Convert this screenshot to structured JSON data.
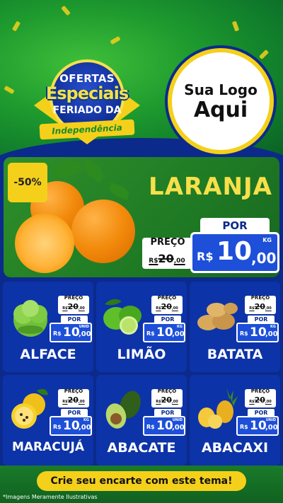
{
  "header": {
    "badge": {
      "line1": "OFERTAS",
      "line2": "Especiais",
      "line3": "FERIADO DA",
      "ribbon": "Independência"
    },
    "logo": {
      "line1": "Sua Logo",
      "line2": "Aqui"
    }
  },
  "hero": {
    "discount": "-50%",
    "name": "LARANJA",
    "preco_label": "PREÇO",
    "old_currency": "R$",
    "old_int": "20",
    "old_dec": ",00",
    "por_label": "POR",
    "currency": "R$",
    "price_int": "10",
    "price_dec": ",00",
    "unit": "KG"
  },
  "products": [
    {
      "name": "ALFACE",
      "preco_label": "PREÇO",
      "old_currency": "R$",
      "old_int": "20",
      "old_dec": ",00",
      "por_label": "POR",
      "currency": "R$",
      "price_int": "10",
      "price_dec": ",00",
      "unit": "UNID"
    },
    {
      "name": "LIMÃO",
      "preco_label": "PREÇO",
      "old_currency": "R$",
      "old_int": "20",
      "old_dec": ",00",
      "por_label": "POR",
      "currency": "R$",
      "price_int": "10",
      "price_dec": ",00",
      "unit": "KG"
    },
    {
      "name": "BATATA",
      "preco_label": "PREÇO",
      "old_currency": "R$",
      "old_int": "20",
      "old_dec": ",00",
      "por_label": "POR",
      "currency": "R$",
      "price_int": "10",
      "price_dec": ",00",
      "unit": "KG"
    },
    {
      "name": "MARACUJÁ",
      "preco_label": "PREÇO",
      "old_currency": "R$",
      "old_int": "20",
      "old_dec": ",00",
      "por_label": "POR",
      "currency": "R$",
      "price_int": "10",
      "price_dec": ",00",
      "unit": "KG"
    },
    {
      "name": "ABACATE",
      "preco_label": "PREÇO",
      "old_currency": "R$",
      "old_int": "20",
      "old_dec": ",00",
      "por_label": "POR",
      "currency": "R$",
      "price_int": "10",
      "price_dec": ",00",
      "unit": "UNID"
    },
    {
      "name": "ABACAXI",
      "preco_label": "PREÇO",
      "old_currency": "R$",
      "old_int": "20",
      "old_dec": ",00",
      "por_label": "POR",
      "currency": "R$",
      "price_int": "10",
      "price_dec": ",00",
      "unit": "UNID"
    }
  ],
  "footer": {
    "cta": "Crie seu encarte com este tema!",
    "note": "*Imagens Meramente Ilustrativas"
  },
  "colors": {
    "brand_green": "#1e9a2e",
    "brand_blue": "#0b2a8c",
    "accent_yellow": "#f4d01b",
    "price_blue": "#1d4fd8"
  }
}
